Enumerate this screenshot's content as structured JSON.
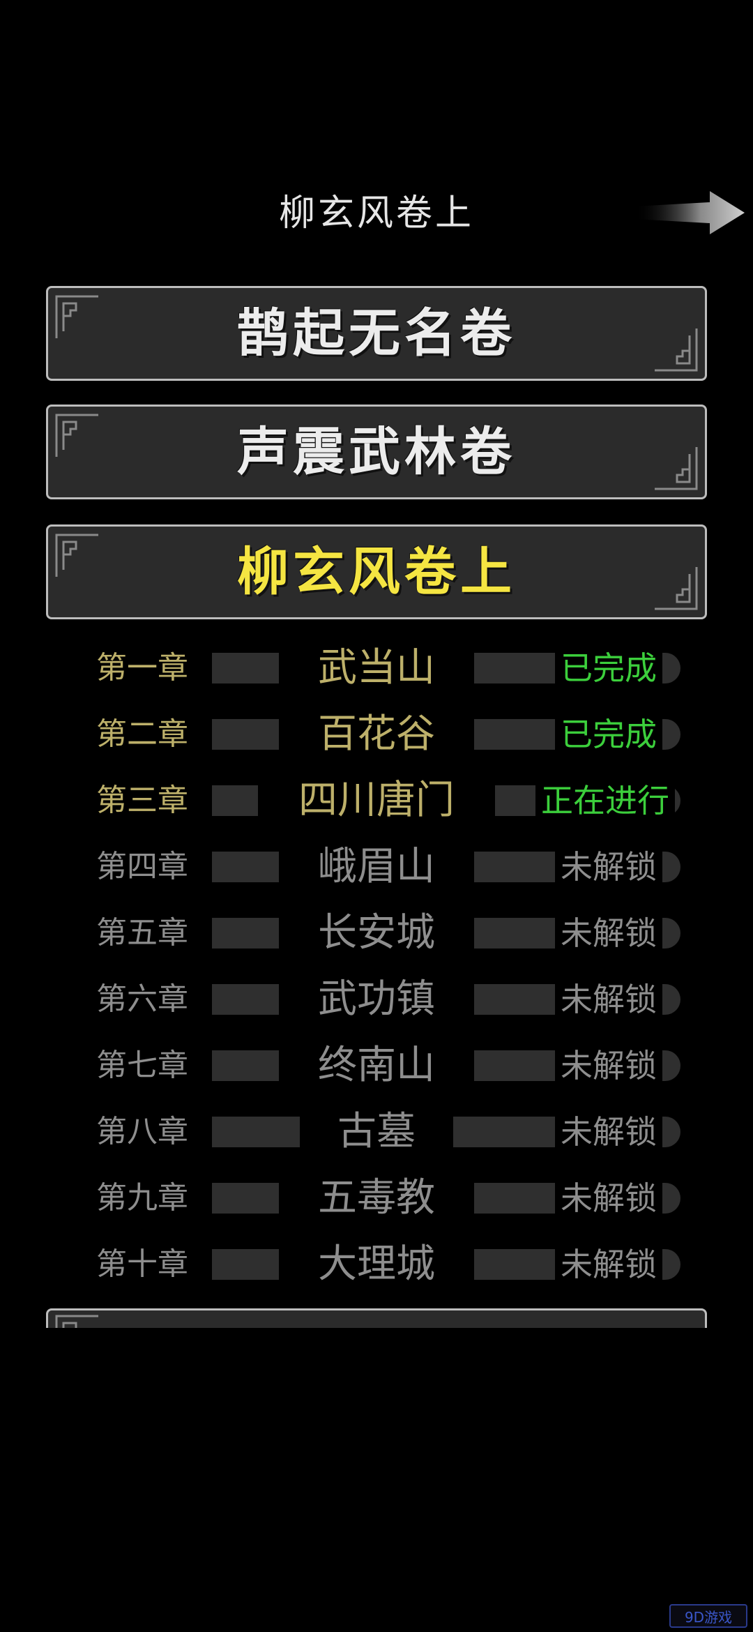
{
  "header": {
    "title": "柳玄风卷上",
    "next_icon": "arrow-right-icon"
  },
  "volumes": [
    {
      "label": "鹊起无名卷",
      "active": false
    },
    {
      "label": "声震武林卷",
      "active": false
    },
    {
      "label": "柳玄风卷上",
      "active": true
    }
  ],
  "chapters": [
    {
      "num": "第一章",
      "name": "武当山",
      "status": "已完成"
    },
    {
      "num": "第二章",
      "name": "百花谷",
      "status": "已完成"
    },
    {
      "num": "第三章",
      "name": "四川唐门",
      "status": "正在进行"
    },
    {
      "num": "第四章",
      "name": "峨眉山",
      "status": "未解锁"
    },
    {
      "num": "第五章",
      "name": "长安城",
      "status": "未解锁"
    },
    {
      "num": "第六章",
      "name": "武功镇",
      "status": "未解锁"
    },
    {
      "num": "第七章",
      "name": "终南山",
      "status": "未解锁"
    },
    {
      "num": "第八章",
      "name": "古墓",
      "status": "未解锁"
    },
    {
      "num": "第九章",
      "name": "五毒教",
      "status": "未解锁"
    },
    {
      "num": "第十章",
      "name": "大理城",
      "status": "未解锁"
    }
  ],
  "colors": {
    "active_volume": "#f5e542",
    "unlocked_chapter": "#bdb06a",
    "status_green": "#3ccf3c",
    "locked_text": "#8e8e8e"
  },
  "watermark": {
    "text": "9D游戏"
  }
}
